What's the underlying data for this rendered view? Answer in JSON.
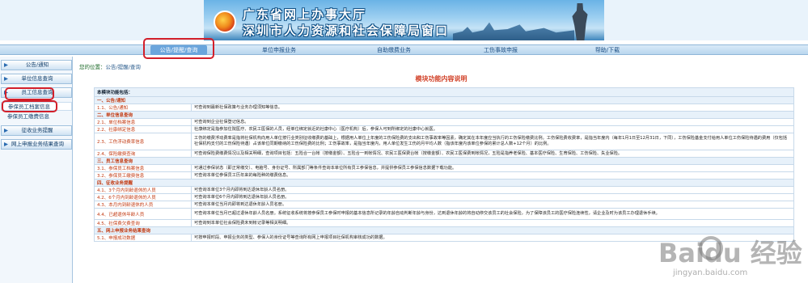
{
  "banner": {
    "line1": "广东省网上办事大厅",
    "line2": "深圳市人力资源和社会保障局窗口"
  },
  "nav": {
    "items": [
      "公告/提醒/查询",
      "单位申报业务",
      "自助缴费业务",
      "工伤事故申报",
      "帮助/下载"
    ]
  },
  "sidebar": {
    "groups": [
      "公告/通知",
      "单位信息查询",
      "员工信息查询",
      "征收业务提醒",
      "网上申报业务结果查询"
    ],
    "subitems": [
      "参保员工档案信息",
      "参保员工缴费信息"
    ]
  },
  "crumb": {
    "label": "您的位置：",
    "path": "公告/提醒/查询"
  },
  "page_title": "模块功能内容说明",
  "table": {
    "intro": "本模块功能包括：",
    "rows": [
      {
        "type": "g",
        "title": "一、公告/通知",
        "desc": ""
      },
      {
        "type": "s",
        "title": "1.1、公告/通知",
        "desc": "可查询到最新社保政策与业务办理须知等信息。"
      },
      {
        "type": "g",
        "title": "二、单位信息查询",
        "desc": ""
      },
      {
        "type": "s",
        "title": "2.1、单位档案信息",
        "desc": "可查询到企业社保登记信息。"
      },
      {
        "type": "s",
        "title": "2.2、社康绑定信息",
        "desc": "社康绑定是指参加住院医疗、农民工医保的人员，经单位绑定就近的社康中心（医疗机构）后，参保人可到所绑定的社康中心就医。"
      },
      {
        "type": "s3",
        "title": "2.3、工伤浮动费率信息",
        "desc": "工伤的缴费浮动费率是指将社保机构向用人单位按行业类别征收缴费的基础上，根据用人单位上年度的工伤保险费的支出和工伤事故率等因素，确定其在本年度应当执行的工伤保险缴费比例。工伤保险费收费率，是指当年度内（每年1月1日至12月31日，下同），工伤保险基金支付给用人单位工伤保险待遇的费用（仅包括社保机构支付的工伤保险待遇）占该单位同期缴纳的工伤保险费的比例；工伤事故率，是指当年度内，用人单位发生工伤的月平均人数（指该年度内该单位参保的累计总人数+12个月）的比例。"
      },
      {
        "type": "s",
        "title": "2.4、保险缴费查询",
        "desc": "可查询保险费缴费情况以及相关明细，查询项目包括：五险合一台帐（按缴金额）、五险合一到帐情况、农民工医保费台帐（按缴金额）、农民工医保费到帐情况，五险是指养老保险、基本医疗保险、生育保险、工伤保险、失业保险。"
      },
      {
        "type": "g",
        "title": "三、员工信息查询",
        "desc": ""
      },
      {
        "type": "s",
        "title": "3.1、参保员工档案信息",
        "desc": "可通过参保状态（即正常缴交）、电脑号、身份证号、所属部门等条件查询本单位所有员工参保信息，并提供参保员工参保信息数据下载功能。"
      },
      {
        "type": "s",
        "title": "3.2、参保员工缴费信息",
        "desc": "可查询本单位参保员工历年来的每险种的缴费信息。"
      },
      {
        "type": "g",
        "title": "四、征收业务提醒",
        "desc": ""
      },
      {
        "type": "s",
        "title": "4.1、3个月内到龄退休的人员",
        "desc": "可查询本单位3个月内即将到达退休年龄人员名册。"
      },
      {
        "type": "s",
        "title": "4.2、6个月内到龄退休的人员",
        "desc": "可查询本单位6个月内即将到达退休年龄人员名册。"
      },
      {
        "type": "s",
        "title": "4.3、本月内到龄退休的人员",
        "desc": "可查询本单位当月内即将到达退休年龄人员名册。"
      },
      {
        "type": "s2",
        "title": "4.4、已超退休年龄人员",
        "desc": "可查询本单位当月已超过退休年龄人员名册。系统征收系统将按参保员工参保时申报的基本信息所记录的年龄自动判断年龄与身份，达到退休年龄的将自动停交该员工的社会保险，为了保障该员工的医疗保险连续性，请企业及时为该员工办理退休手续。"
      },
      {
        "type": "s",
        "title": "4.5、社保费欠费查询",
        "desc": "可查询到本单位社会保险费未到帐记录等相关明细。"
      },
      {
        "type": "g",
        "title": "五、网上申报业务结果查询",
        "desc": ""
      },
      {
        "type": "s",
        "title": "5.1、申报成功数据",
        "desc": "可按申报时段、申报业务的类型、参保人的身份证号等查询所有网上申报项目社保机构审核成功的数据。"
      }
    ]
  },
  "watermark": {
    "big": "Baidu 经验",
    "small": "jingyan.baidu.com"
  },
  "colors": {
    "highlight": "#d21f2a",
    "nav_active": "#6aa5dc",
    "group_title": "#c23a12"
  }
}
